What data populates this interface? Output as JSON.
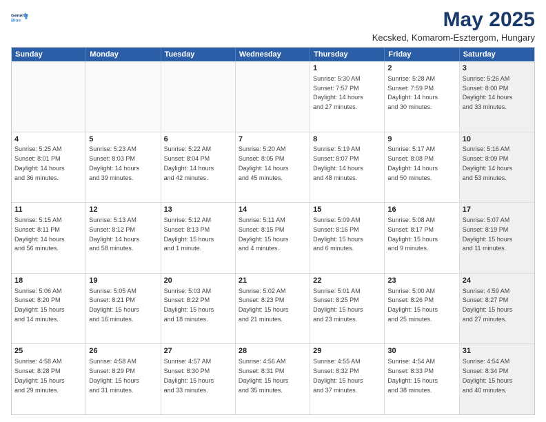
{
  "logo": {
    "line1": "General",
    "line2": "Blue"
  },
  "title": "May 2025",
  "subtitle": "Kecsked, Komarom-Esztergom, Hungary",
  "header_days": [
    "Sunday",
    "Monday",
    "Tuesday",
    "Wednesday",
    "Thursday",
    "Friday",
    "Saturday"
  ],
  "weeks": [
    [
      {
        "day": "",
        "text": "",
        "empty": true
      },
      {
        "day": "",
        "text": "",
        "empty": true
      },
      {
        "day": "",
        "text": "",
        "empty": true
      },
      {
        "day": "",
        "text": "",
        "empty": true
      },
      {
        "day": "1",
        "text": "Sunrise: 5:30 AM\nSunset: 7:57 PM\nDaylight: 14 hours\nand 27 minutes."
      },
      {
        "day": "2",
        "text": "Sunrise: 5:28 AM\nSunset: 7:59 PM\nDaylight: 14 hours\nand 30 minutes."
      },
      {
        "day": "3",
        "text": "Sunrise: 5:26 AM\nSunset: 8:00 PM\nDaylight: 14 hours\nand 33 minutes.",
        "shaded": true
      }
    ],
    [
      {
        "day": "4",
        "text": "Sunrise: 5:25 AM\nSunset: 8:01 PM\nDaylight: 14 hours\nand 36 minutes."
      },
      {
        "day": "5",
        "text": "Sunrise: 5:23 AM\nSunset: 8:03 PM\nDaylight: 14 hours\nand 39 minutes."
      },
      {
        "day": "6",
        "text": "Sunrise: 5:22 AM\nSunset: 8:04 PM\nDaylight: 14 hours\nand 42 minutes."
      },
      {
        "day": "7",
        "text": "Sunrise: 5:20 AM\nSunset: 8:05 PM\nDaylight: 14 hours\nand 45 minutes."
      },
      {
        "day": "8",
        "text": "Sunrise: 5:19 AM\nSunset: 8:07 PM\nDaylight: 14 hours\nand 48 minutes."
      },
      {
        "day": "9",
        "text": "Sunrise: 5:17 AM\nSunset: 8:08 PM\nDaylight: 14 hours\nand 50 minutes."
      },
      {
        "day": "10",
        "text": "Sunrise: 5:16 AM\nSunset: 8:09 PM\nDaylight: 14 hours\nand 53 minutes.",
        "shaded": true
      }
    ],
    [
      {
        "day": "11",
        "text": "Sunrise: 5:15 AM\nSunset: 8:11 PM\nDaylight: 14 hours\nand 56 minutes."
      },
      {
        "day": "12",
        "text": "Sunrise: 5:13 AM\nSunset: 8:12 PM\nDaylight: 14 hours\nand 58 minutes."
      },
      {
        "day": "13",
        "text": "Sunrise: 5:12 AM\nSunset: 8:13 PM\nDaylight: 15 hours\nand 1 minute."
      },
      {
        "day": "14",
        "text": "Sunrise: 5:11 AM\nSunset: 8:15 PM\nDaylight: 15 hours\nand 4 minutes."
      },
      {
        "day": "15",
        "text": "Sunrise: 5:09 AM\nSunset: 8:16 PM\nDaylight: 15 hours\nand 6 minutes."
      },
      {
        "day": "16",
        "text": "Sunrise: 5:08 AM\nSunset: 8:17 PM\nDaylight: 15 hours\nand 9 minutes."
      },
      {
        "day": "17",
        "text": "Sunrise: 5:07 AM\nSunset: 8:19 PM\nDaylight: 15 hours\nand 11 minutes.",
        "shaded": true
      }
    ],
    [
      {
        "day": "18",
        "text": "Sunrise: 5:06 AM\nSunset: 8:20 PM\nDaylight: 15 hours\nand 14 minutes."
      },
      {
        "day": "19",
        "text": "Sunrise: 5:05 AM\nSunset: 8:21 PM\nDaylight: 15 hours\nand 16 minutes."
      },
      {
        "day": "20",
        "text": "Sunrise: 5:03 AM\nSunset: 8:22 PM\nDaylight: 15 hours\nand 18 minutes."
      },
      {
        "day": "21",
        "text": "Sunrise: 5:02 AM\nSunset: 8:23 PM\nDaylight: 15 hours\nand 21 minutes."
      },
      {
        "day": "22",
        "text": "Sunrise: 5:01 AM\nSunset: 8:25 PM\nDaylight: 15 hours\nand 23 minutes."
      },
      {
        "day": "23",
        "text": "Sunrise: 5:00 AM\nSunset: 8:26 PM\nDaylight: 15 hours\nand 25 minutes."
      },
      {
        "day": "24",
        "text": "Sunrise: 4:59 AM\nSunset: 8:27 PM\nDaylight: 15 hours\nand 27 minutes.",
        "shaded": true
      }
    ],
    [
      {
        "day": "25",
        "text": "Sunrise: 4:58 AM\nSunset: 8:28 PM\nDaylight: 15 hours\nand 29 minutes."
      },
      {
        "day": "26",
        "text": "Sunrise: 4:58 AM\nSunset: 8:29 PM\nDaylight: 15 hours\nand 31 minutes."
      },
      {
        "day": "27",
        "text": "Sunrise: 4:57 AM\nSunset: 8:30 PM\nDaylight: 15 hours\nand 33 minutes."
      },
      {
        "day": "28",
        "text": "Sunrise: 4:56 AM\nSunset: 8:31 PM\nDaylight: 15 hours\nand 35 minutes."
      },
      {
        "day": "29",
        "text": "Sunrise: 4:55 AM\nSunset: 8:32 PM\nDaylight: 15 hours\nand 37 minutes."
      },
      {
        "day": "30",
        "text": "Sunrise: 4:54 AM\nSunset: 8:33 PM\nDaylight: 15 hours\nand 38 minutes."
      },
      {
        "day": "31",
        "text": "Sunrise: 4:54 AM\nSunset: 8:34 PM\nDaylight: 15 hours\nand 40 minutes.",
        "shaded": true
      }
    ]
  ]
}
